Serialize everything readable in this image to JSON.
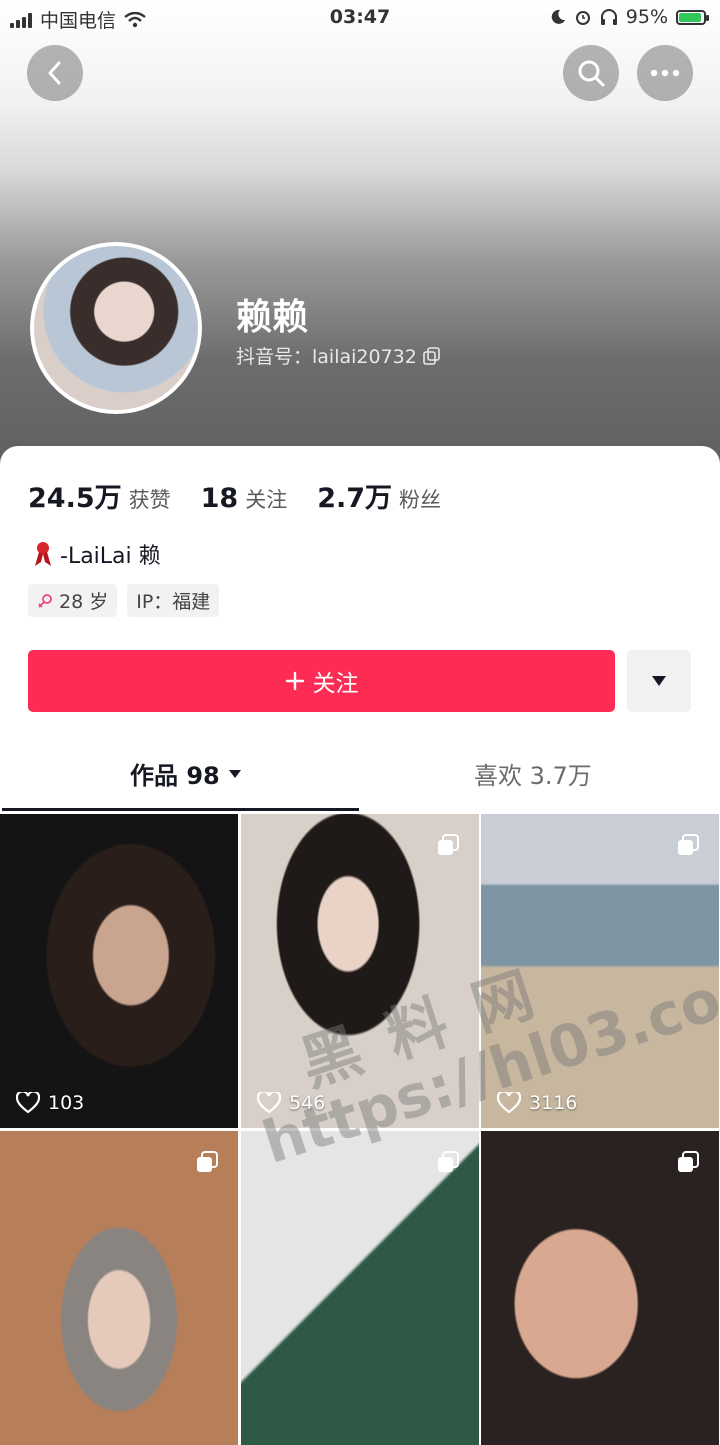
{
  "status_bar": {
    "carrier": "中国电信",
    "time": "03:47",
    "battery": "95%"
  },
  "profile": {
    "name": "赖赖",
    "douyin_id": "抖音号：lailai20732",
    "stats": [
      {
        "value": "24.5万",
        "label": "获赞"
      },
      {
        "value": "18",
        "label": "关注"
      },
      {
        "value": "2.7万",
        "label": "粉丝"
      }
    ],
    "bio": "-LaiLai 赖",
    "tags": {
      "age": "28 岁",
      "ip": "IP：福建"
    }
  },
  "actions": {
    "follow_label": "关注"
  },
  "tabs": {
    "works": "作品 98",
    "likes": "喜欢 3.7万"
  },
  "videos": [
    {
      "likes": "103"
    },
    {
      "likes": "546"
    },
    {
      "likes": "3116"
    },
    {
      "likes": ""
    },
    {
      "likes": ""
    },
    {
      "likes": ""
    }
  ],
  "watermark": {
    "line1": "黑料网",
    "line2": "https://hl03.co"
  },
  "colors": {
    "accent": "#fe2c55"
  }
}
